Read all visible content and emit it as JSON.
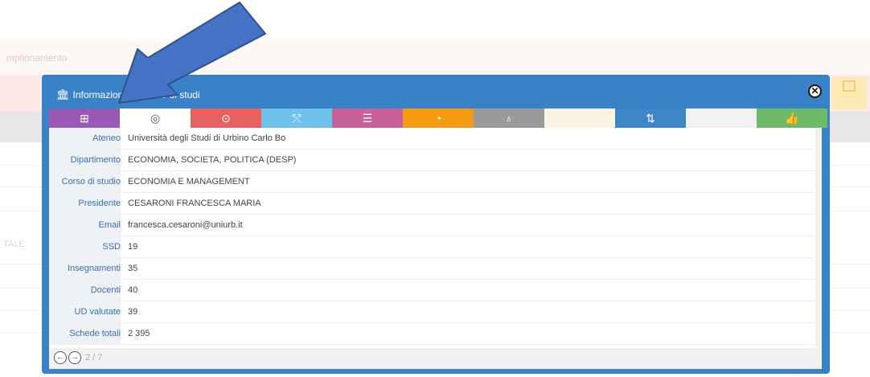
{
  "background": {
    "bar_text": "mplionamento",
    "side_text": "TALE"
  },
  "modal": {
    "title": "Informazioni sul corso di studi",
    "title_icon": "university-icon",
    "close_icon": "close-circle-icon",
    "tabs": [
      {
        "icon": "presentation-icon",
        "glyph": "⊞",
        "color": "#9b59b6"
      },
      {
        "icon": "target-icon",
        "glyph": "◎",
        "color": "#ffffff"
      },
      {
        "icon": "bullseye-icon",
        "glyph": "⊙",
        "color": "#e8605f"
      },
      {
        "icon": "line-chart-icon",
        "glyph": "⤲",
        "color": "#6fc3ea"
      },
      {
        "icon": "list-icon",
        "glyph": "☰",
        "color": "#c9609b"
      },
      {
        "icon": "gauge-icon",
        "glyph": "◔",
        "color": "#f39c12"
      },
      {
        "icon": "lightbulb-icon",
        "glyph": "♁",
        "color": "#9a9a9a"
      },
      {
        "icon": "blank-tab-icon",
        "glyph": "",
        "color": "#fdf3e4"
      },
      {
        "icon": "sort-icon",
        "glyph": "⇅",
        "color": "#3f86c8"
      },
      {
        "icon": "blank-tab-icon",
        "glyph": "",
        "color": "#f2f2f2"
      },
      {
        "icon": "thumbs-up-icon",
        "glyph": "👍",
        "color": "#6dbb6a"
      }
    ],
    "rows": [
      {
        "label": "Ateneo",
        "value": "Università degli Studi di Urbino Carlo Bo"
      },
      {
        "label": "Dipartimento",
        "value": "ECONOMIA, SOCIETA, POLITICA (DESP)"
      },
      {
        "label": "Corso di studio",
        "value": "ECONOMIA E MANAGEMENT"
      },
      {
        "label": "Presidente",
        "value": "CESARONI FRANCESCA MARIA"
      },
      {
        "label": "Email",
        "value": "francesca.cesaroni@uniurb.it"
      },
      {
        "label": "SSD",
        "value": "19"
      },
      {
        "label": "Insegnamenti",
        "value": "35"
      },
      {
        "label": "Docenti",
        "value": "40"
      },
      {
        "label": "UD valutate",
        "value": "39"
      },
      {
        "label": "Schede totali",
        "value": "2 395"
      }
    ],
    "footer": {
      "prev_icon": "arrow-left-circle-icon",
      "next_icon": "arrow-right-circle-icon",
      "pager": "2 / 7"
    }
  },
  "colors": {
    "modal_blue": "#3a82c8",
    "arrow_fill": "#4472c4",
    "arrow_stroke": "#2f528f"
  }
}
